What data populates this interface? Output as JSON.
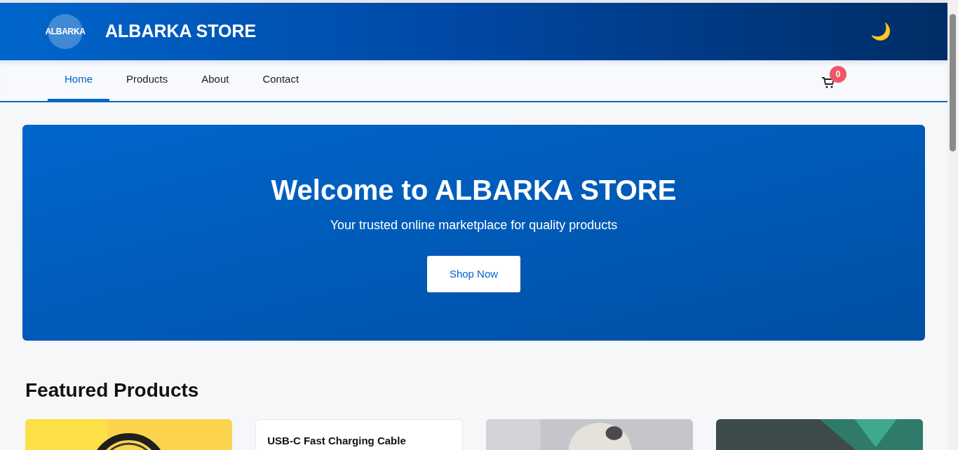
{
  "header": {
    "logo": "ALBARKA",
    "title": "ALBARKA STORE",
    "theme_icon": "🌙"
  },
  "nav": {
    "items": [
      {
        "label": "Home",
        "selected": true
      },
      {
        "label": "Products",
        "selected": false
      },
      {
        "label": "About",
        "selected": false
      },
      {
        "label": "Contact",
        "selected": false
      }
    ],
    "cart_count": "0"
  },
  "hero": {
    "title": "Welcome to ALBARKA STORE",
    "subtitle": "Your trusted online marketplace for quality products",
    "button": "Shop Now"
  },
  "featured": {
    "title": "Featured Products",
    "products": [
      {
        "kind": "picture"
      },
      {
        "kind": "text",
        "name": "USB-C Fast Charging Cable"
      },
      {
        "kind": "picture"
      },
      {
        "kind": "picture"
      }
    ]
  }
}
